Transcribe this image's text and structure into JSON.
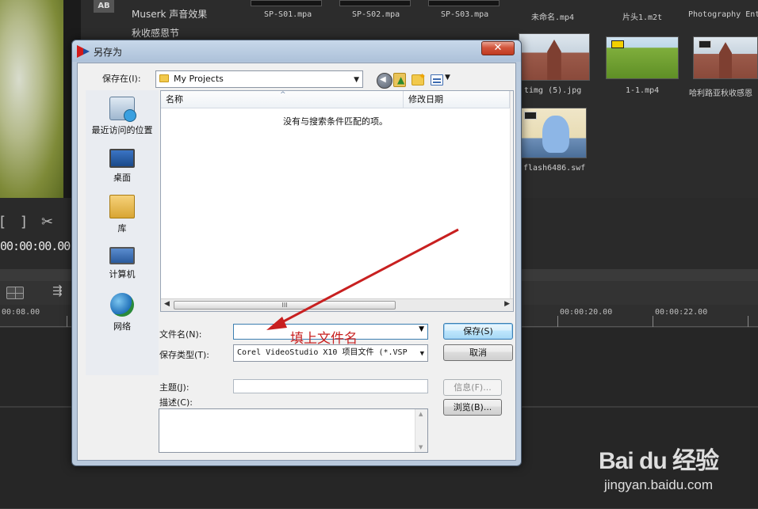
{
  "app": {
    "library": {
      "list_items": [
        "Muserk 声音效果",
        "秋收感恩节"
      ],
      "thumbnails_row1": [
        "SP-S01.mpa",
        "SP-S02.mpa",
        "SP-S03.mpa",
        "未命名.mp4",
        "片头1.m2t",
        "Photography Ent"
      ],
      "thumbnails_row2": [
        "timg (5).jpg",
        "1-1.mp4",
        "哈利路亚秋收感恩"
      ],
      "thumbnails_row3": [
        "flash6486.swf"
      ],
      "ab_icon": "AB"
    },
    "timecode": "00:00:00.00",
    "ruler": [
      "00:08.00",
      "00:00:20.00",
      "00:00:22.00"
    ]
  },
  "dialog": {
    "title": "另存为",
    "close_glyph": "✕",
    "save_in_label": "保存在(I):",
    "save_in_value": "My Projects",
    "places": [
      "最近访问的位置",
      "桌面",
      "库",
      "计算机",
      "网络"
    ],
    "columns": {
      "name": "名称",
      "modified": "修改日期"
    },
    "empty_message": "没有与搜索条件匹配的项。",
    "scroll_grip": "III",
    "filename_label": "文件名(N):",
    "filename_value": "",
    "filetype_label": "保存类型(T):",
    "filetype_value": "Corel VideoStudio X10 项目文件 (*.VSP",
    "subject_label": "主题(J):",
    "description_label": "描述(C):",
    "buttons": {
      "save": "保存(S)",
      "cancel": "取消",
      "info": "信息(F)...",
      "browse": "浏览(B)..."
    }
  },
  "annotation": {
    "text": "填上文件名",
    "color": "#c82020"
  },
  "watermark": {
    "brand": "Bai du 经验",
    "url": "jingyan.baidu.com"
  }
}
